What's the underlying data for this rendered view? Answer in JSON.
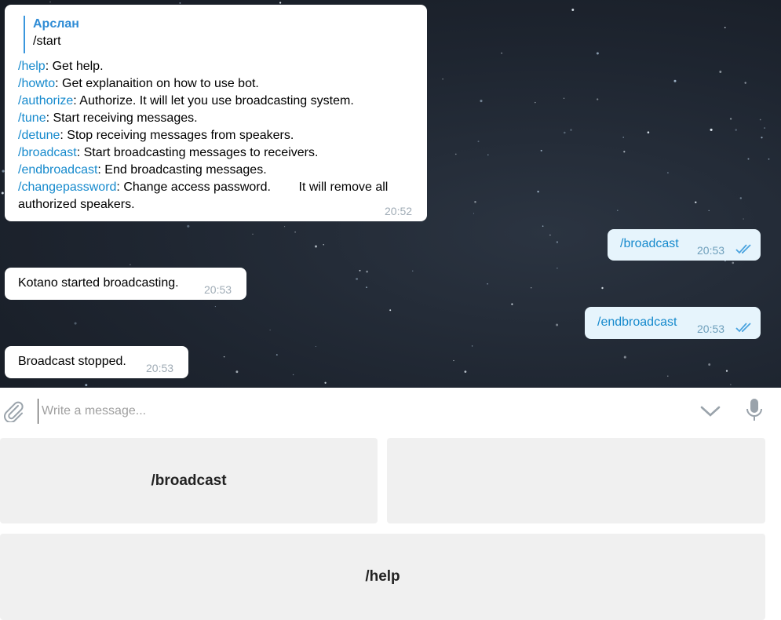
{
  "messages": {
    "bot_help": {
      "reply_name": "Арслан",
      "reply_text": "/start",
      "lines": [
        {
          "cmd": "/help",
          "text": ": Get help."
        },
        {
          "cmd": "/howto",
          "text": ": Get explanaition on how to use bot."
        },
        {
          "cmd": "/authorize",
          "text": ": Authorize. It will let you use broadcasting system."
        },
        {
          "cmd": "/tune",
          "text": ": Start receiving messages."
        },
        {
          "cmd": "/detune",
          "text": ": Stop receiving messages from speakers."
        },
        {
          "cmd": "/broadcast",
          "text": ": Start broadcasting messages to receivers."
        },
        {
          "cmd": "/endbroadcast",
          "text": ": End broadcasting messages."
        },
        {
          "cmd": "/changepassword",
          "text": ": Change access password.        It will remove all"
        }
      ],
      "last_line": "authorized speakers.",
      "time": "20:52"
    },
    "user_broadcast": {
      "text": "/broadcast",
      "time": "20:53"
    },
    "bot_started": {
      "text": "Kotano started broadcasting.",
      "time": "20:53"
    },
    "user_endbroadcast": {
      "text": "/endbroadcast",
      "time": "20:53"
    },
    "bot_stopped": {
      "text": "Broadcast stopped.",
      "time": "20:53"
    }
  },
  "input": {
    "placeholder": "Write a message..."
  },
  "icons": {
    "attach": "paperclip-icon",
    "keyboard_toggle": "chevron-down-icon",
    "voice": "microphone-icon",
    "read": "double-check-icon"
  },
  "keyboard": {
    "row1": [
      "/broadcast",
      ""
    ],
    "row2": [
      "/help"
    ]
  },
  "colors": {
    "link": "#168acd",
    "outgoing_bubble": "#e6f4fc",
    "keyboard_button": "#f0f0f0"
  }
}
